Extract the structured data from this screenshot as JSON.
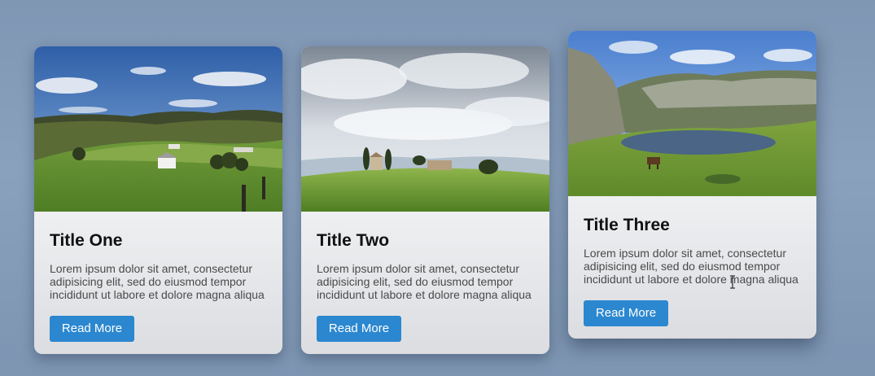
{
  "cards": [
    {
      "title": "Title One",
      "text": "Lorem ipsum dolor sit amet, consectetur adipisicing elit, sed do eiusmod tempor incididunt ut labore et dolore magna aliqua",
      "button": "Read More",
      "image": "farm-landscape"
    },
    {
      "title": "Title Two",
      "text": "Lorem ipsum dolor sit amet, consectetur adipisicing elit, sed do eiusmod tempor incididunt ut labore et dolore magna aliqua",
      "button": "Read More",
      "image": "tuscany-hill"
    },
    {
      "title": "Title Three",
      "text": "Lorem ipsum dolor sit amet, consectetur adipisicing elit, sed do eiusmod tempor incididunt ut labore et dolore magna aliqua",
      "button": "Read More",
      "image": "mountain-lake"
    }
  ],
  "colors": {
    "background": "#8aa1bd",
    "button": "#2b87cf",
    "card": "#f3f4f5"
  }
}
